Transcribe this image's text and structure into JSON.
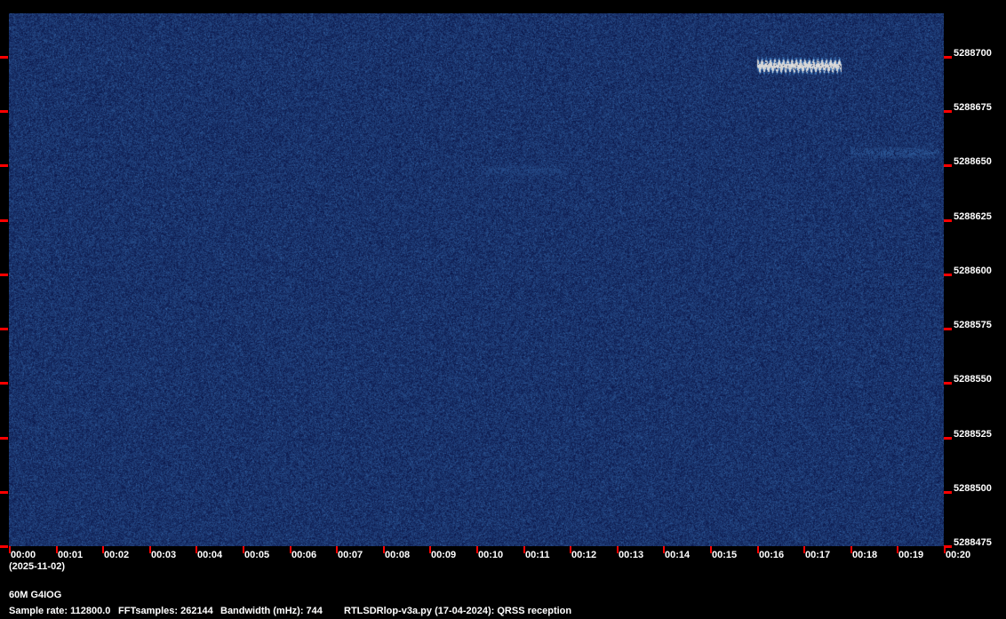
{
  "chart_data": {
    "type": "heatmap",
    "title": "60M G4IOG",
    "xlabel": "(2025-11-02)",
    "ylabel": "",
    "x_unit": "minutes",
    "xlim": [
      0,
      20
    ],
    "ylim": [
      5288475,
      5288720
    ],
    "x_ticks": [
      "00:00",
      "00:01",
      "00:02",
      "00:03",
      "00:04",
      "00:05",
      "00:06",
      "00:07",
      "00:08",
      "00:09",
      "00:10",
      "00:11",
      "00:12",
      "00:13",
      "00:14",
      "00:15",
      "00:16",
      "00:17",
      "00:18",
      "00:19",
      "00:20"
    ],
    "y_ticks": [
      5288700,
      5288675,
      5288650,
      5288625,
      5288600,
      5288575,
      5288550,
      5288525,
      5288500,
      5288475
    ],
    "colormap": [
      "#00103a",
      "#0a3a80",
      "#2a6ab0",
      "#d8d8d8"
    ],
    "signals": [
      {
        "t_start": 10.1,
        "t_end": 11.8,
        "freq": 5288648,
        "strength": 0.45
      },
      {
        "t_start": 16.0,
        "t_end": 17.8,
        "freq": 5288696,
        "strength": 1.0
      },
      {
        "t_start": 18.0,
        "t_end": 19.9,
        "freq": 5288656,
        "strength": 0.55
      }
    ]
  },
  "footer": {
    "station": "60M G4IOG",
    "sample_rate": "Sample rate: 112800.0",
    "fft_samples": "FFTsamples: 262144",
    "bandwidth": "Bandwidth (mHz): 744",
    "software": "RTLSDRlop-v3a.py (17-04-2024): QRSS reception"
  }
}
